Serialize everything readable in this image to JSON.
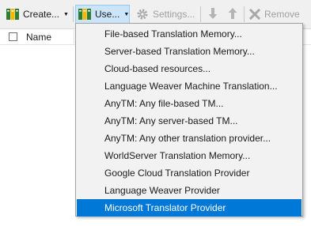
{
  "toolbar": {
    "create_label": "Create...",
    "use_label": "Use...",
    "settings_label": "Settings...",
    "remove_label": "Remove",
    "colors": {
      "use_active_bg": "#cce4f7",
      "disabled_text": "#a0a0a0"
    }
  },
  "list": {
    "name_header": "Name"
  },
  "menu": {
    "items": [
      {
        "label": "File-based Translation Memory..."
      },
      {
        "label": "Server-based Translation Memory..."
      },
      {
        "label": "Cloud-based resources..."
      },
      {
        "label": "Language Weaver Machine Translation..."
      },
      {
        "label": "AnyTM: Any file-based TM..."
      },
      {
        "label": "AnyTM: Any server-based TM..."
      },
      {
        "label": "AnyTM: Any other translation provider..."
      },
      {
        "label": "WorldServer Translation Memory..."
      },
      {
        "label": "Google Cloud Translation Provider"
      },
      {
        "label": "Language Weaver Provider"
      },
      {
        "label": "Microsoft Translator Provider"
      }
    ],
    "selected_label": "Microsoft Translator Provider",
    "selection_color": "#0078d7"
  }
}
